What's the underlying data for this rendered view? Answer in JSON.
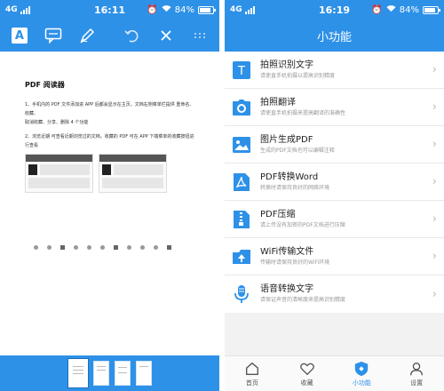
{
  "colors": {
    "primary": "#2e91e8",
    "background": "#f2f2f2"
  },
  "left_screen": {
    "status": {
      "network": "4G",
      "time": "16:11",
      "battery": "84%",
      "battery_level": 0.84
    },
    "toolbar": {
      "icons": [
        "text-style-icon",
        "comment-icon",
        "pen-icon",
        "undo-icon",
        "close-icon",
        "more-icon"
      ]
    },
    "document": {
      "title": "PDF 阅读器",
      "line1": "1、手机内的 PDF 文件添加进 APP 后都会显示在主页，文档右侧菜单栏提供 重命名、收藏、",
      "line1b": "取消收藏、分享、删除 4 个功能",
      "line2": "2、浏览近期 可查看近期浏览过的文档，收藏的 PDF 可在 APP 下端菜单的收藏按钮进行查看",
      "thumb_label": "abc.pdf"
    },
    "thumbnails": 4
  },
  "right_screen": {
    "status": {
      "network": "4G",
      "time": "16:19",
      "battery": "84%",
      "battery_level": 0.84
    },
    "header": {
      "title": "小功能"
    },
    "features": [
      {
        "title": "拍照识别文字",
        "desc": "请使直手机拍摄以提高识别精度",
        "icon": "text-recognition-icon"
      },
      {
        "title": "拍照翻译",
        "desc": "请使直手机拍摄来提高翻译的准确性",
        "icon": "camera-icon"
      },
      {
        "title": "图片生成PDF",
        "desc": "生成的PDF文档也可以编辑注释",
        "icon": "image-icon"
      },
      {
        "title": "PDF转换Word",
        "desc": "转换时请保持良好的网络环境",
        "icon": "pdf-convert-icon"
      },
      {
        "title": "PDF压缩",
        "desc": "请上传没有加密的PDF文档进行压缩",
        "icon": "zip-icon"
      },
      {
        "title": "WiFi传输文件",
        "desc": "传输时请保持良好的WiFi环境",
        "icon": "wifi-transfer-icon"
      },
      {
        "title": "语音转换文字",
        "desc": "请保证声音的清晰度来提高识别精度",
        "icon": "microphone-icon"
      }
    ],
    "tabs": [
      {
        "label": "首页",
        "icon": "home-icon"
      },
      {
        "label": "收藏",
        "icon": "heart-icon"
      },
      {
        "label": "小功能",
        "icon": "tools-icon",
        "active": true
      },
      {
        "label": "设置",
        "icon": "user-icon"
      }
    ]
  }
}
